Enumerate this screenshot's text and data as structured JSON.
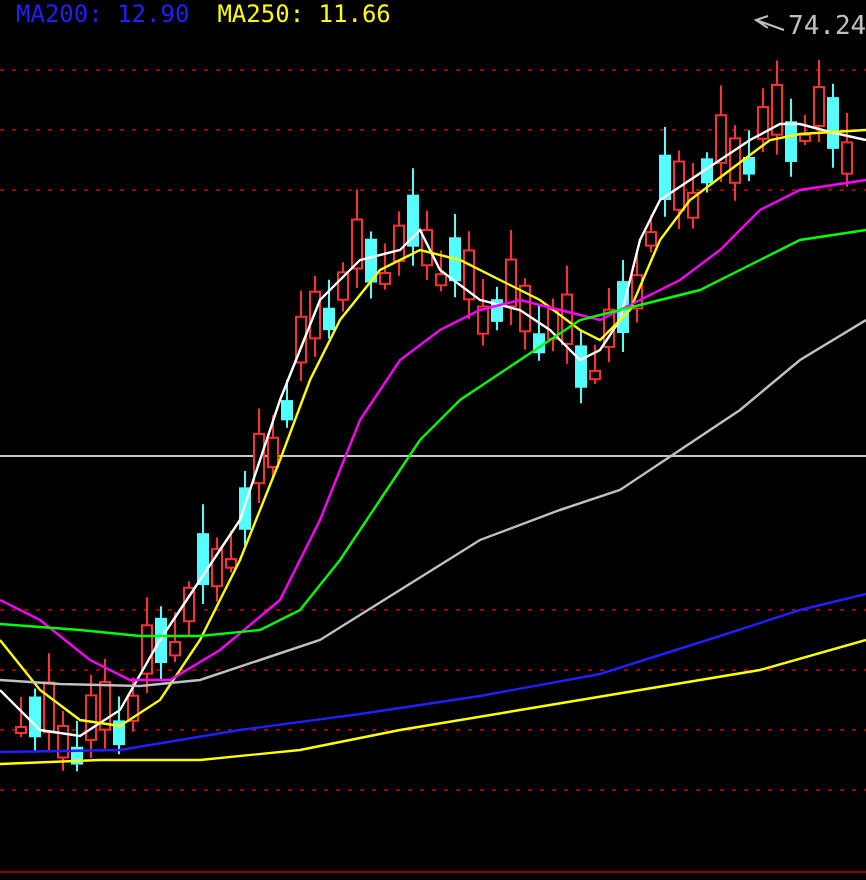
{
  "legend": [
    {
      "text": "MA200: 12.90",
      "color": "#2020ff"
    },
    {
      "text": "MA250: 11.66",
      "color": "#ffff00"
    }
  ],
  "max_price_label": "74.24"
}
